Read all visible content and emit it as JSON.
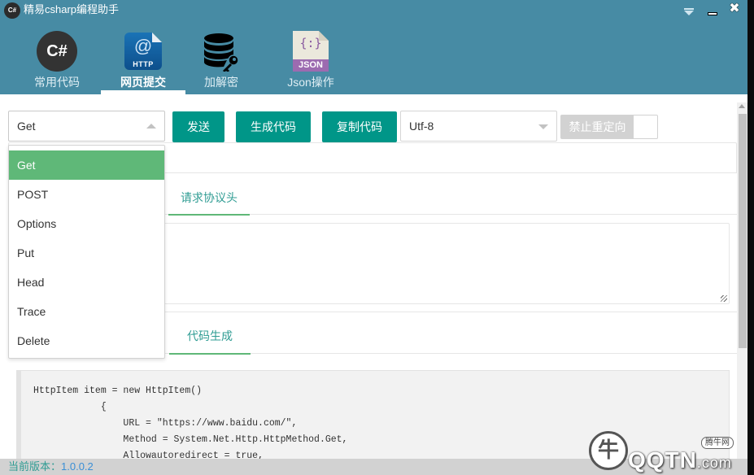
{
  "window": {
    "logo_text": "C#",
    "title": "精易csharp编程助手",
    "menu_icon": "dropdown-menu-icon",
    "minimize_icon": "minimize-icon",
    "close_icon": "close-icon",
    "close_glyph": "✖"
  },
  "nav": {
    "items": [
      {
        "label": "常用代码",
        "icon": "csharp-icon",
        "icon_text": "C#",
        "active": false
      },
      {
        "label": "网页提交",
        "icon": "http-icon",
        "icon_text": "@",
        "icon_sub": "HTTP",
        "active": true
      },
      {
        "label": "加解密",
        "icon": "database-key-icon",
        "active": false
      },
      {
        "label": "Json操作",
        "icon": "json-file-icon",
        "icon_text": "{:}",
        "icon_sub": "JSON",
        "active": false
      }
    ]
  },
  "toolbar": {
    "method_select_value": "Get",
    "send_label": "发送",
    "generate_label": "生成代码",
    "copy_label": "复制代码",
    "encoding_select_value": "Utf-8",
    "redirect_switch_label": "禁止重定向",
    "redirect_switch_on": false
  },
  "url_input": {
    "value": "",
    "placeholder": ""
  },
  "method_dropdown": {
    "options": [
      "Get",
      "POST",
      "Options",
      "Put",
      "Head",
      "Trace",
      "Delete"
    ],
    "selected": "Get"
  },
  "request_headers": {
    "tab_label": "请求协议头",
    "value": ""
  },
  "code_gen": {
    "tab_label": "代码生成",
    "code_lines": [
      "HttpItem item = new HttpItem()",
      "            {",
      "                URL = \"https://www.baidu.com/\",",
      "                Method = System.Net.Http.HttpMethod.Get,",
      "                Allowautoredirect = true,"
    ]
  },
  "statusbar": {
    "version_label": "当前版本：",
    "version_value": "1.0.0.2"
  },
  "watermark": {
    "text": "QQTN",
    "suffix": ".com",
    "tag": "腾牛网"
  },
  "colors": {
    "header_bg": "#478ba4",
    "primary_button": "#009688",
    "selected_option": "#5fb878",
    "tab_text": "#2f9c93",
    "version_value": "#3a8fd6"
  }
}
